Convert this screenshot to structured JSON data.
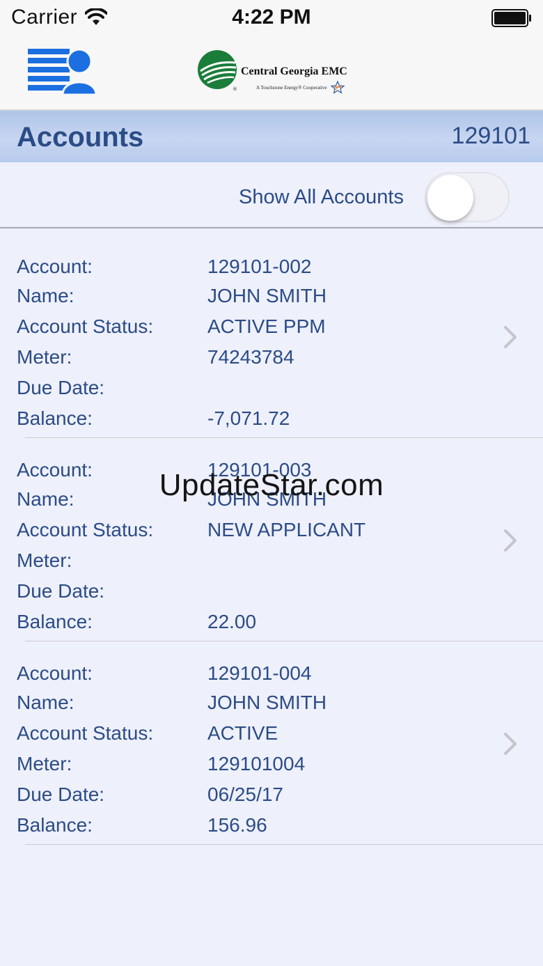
{
  "status_bar": {
    "carrier": "Carrier",
    "time": "4:22 PM"
  },
  "nav": {
    "logo_title": "Central Georgia EMC",
    "logo_subtitle": "A Touchstone Energy® Cooperative"
  },
  "header": {
    "title": "Accounts",
    "number": "129101"
  },
  "toggle": {
    "label": "Show All Accounts",
    "on": false
  },
  "field_labels": {
    "account": "Account:",
    "name": "Name:",
    "status": "Account Status:",
    "meter": "Meter:",
    "due_date": "Due Date:",
    "balance": "Balance:"
  },
  "accounts": [
    {
      "account": "129101-002",
      "name": "JOHN SMITH",
      "status": "ACTIVE PPM",
      "meter": "74243784",
      "due_date": "",
      "balance": "-7,071.72"
    },
    {
      "account": "129101-003",
      "name": "JOHN SMITH",
      "status": "NEW APPLICANT",
      "meter": "",
      "due_date": "",
      "balance": "22.00"
    },
    {
      "account": "129101-004",
      "name": "JOHN SMITH",
      "status": "ACTIVE",
      "meter": "129101004",
      "due_date": "06/25/17",
      "balance": "156.96"
    }
  ],
  "watermark": "UpdateStar.com",
  "colors": {
    "accent": "#2b4c86",
    "icon_blue": "#1b6fe0",
    "logo_green": "#1a7d3a"
  }
}
